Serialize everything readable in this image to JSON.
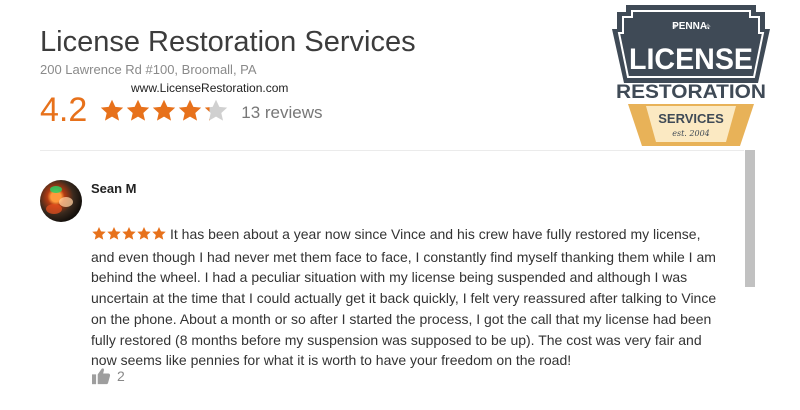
{
  "business": {
    "name": "License Restoration Services",
    "address": "200 Lawrence Rd #100, Broomall, PA",
    "website": "www.LicenseRestoration.com",
    "rating": "4.2",
    "rating_value": 4.2,
    "rating_max": 5,
    "review_count": "13 reviews"
  },
  "logo": {
    "top_text": "PENNA.",
    "main_text": "LICENSE",
    "middle_text": "RESTORATION",
    "badge_text": "SERVICES",
    "est_text": "est. 2004"
  },
  "review": {
    "author": "Sean M",
    "stars": 5,
    "text": "It has been about a year now since Vince and his crew have fully restored my license, and even though I had never met them face to face, I constantly find myself thanking them while I am behind the wheel. I had a peculiar situation with my license being suspended and although I was uncertain at the time that I could actually get it back quickly, I felt very reassured after talking to Vince on the phone. About a month or so after I started the process, I got the call that my license had been fully restored (8 months before my suspension was supposed to be up). The cost was very fair and now seems like pennies for what it is worth to have your freedom on the road!",
    "likes": "2"
  },
  "colors": {
    "star_orange": "#e7711b",
    "star_empty": "#d0d0d0",
    "logo_dark": "#3f4a56",
    "logo_gold": "#e8b258"
  },
  "icons": {
    "rating_stars": "star-icon",
    "like": "thumbs-up-icon"
  }
}
